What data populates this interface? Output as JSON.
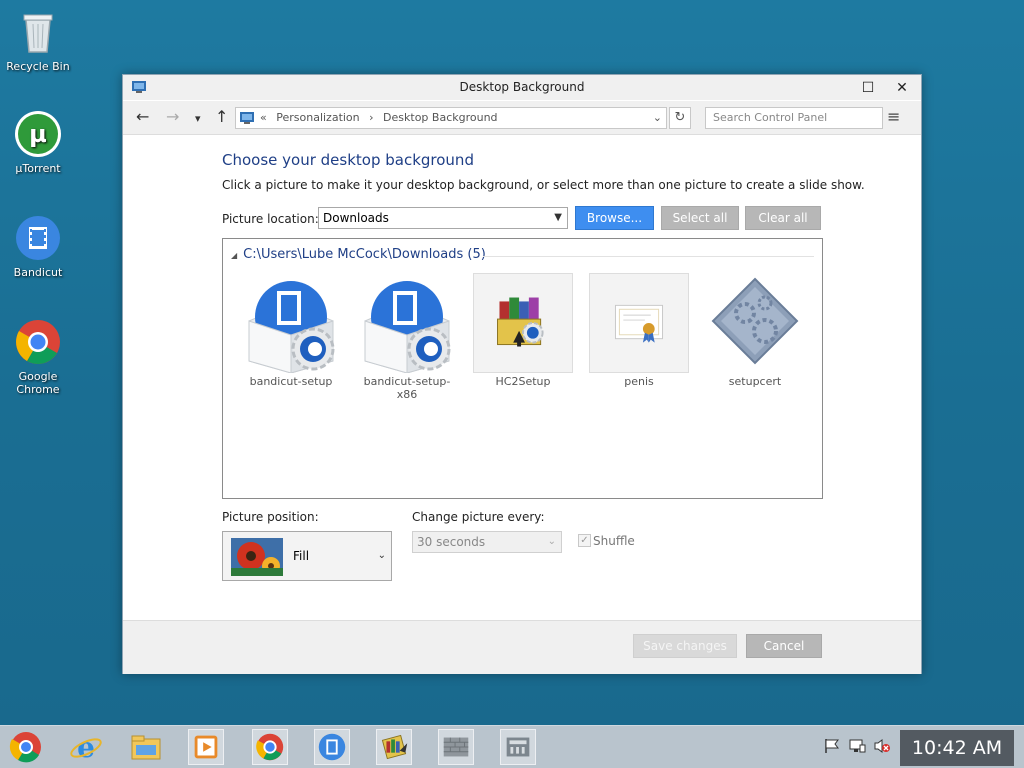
{
  "desktop": {
    "icons": [
      {
        "label": "Recycle Bin"
      },
      {
        "label": "µTorrent"
      },
      {
        "label": "Bandicut"
      },
      {
        "label": "Google Chrome"
      }
    ]
  },
  "window": {
    "title": "Desktop Background",
    "maximize_glyph": "☐",
    "close_glyph": "✕"
  },
  "navbar": {
    "back_glyph": "←",
    "forward_glyph": "→",
    "recent_glyph": "▾",
    "up_glyph": "↑",
    "address_prefix": "«",
    "breadcrumbs": [
      "Personalization",
      "›",
      "Desktop Background"
    ],
    "address_dropdown_glyph": "⌄",
    "refresh_glyph": "↻",
    "search_placeholder": "Search Control Panel",
    "menu_glyph": "≡"
  },
  "content": {
    "heading": "Choose your desktop background",
    "subtext": "Click a picture to make it your desktop background, or select more than one picture to create a slide show.",
    "picture_location_label": "Picture location:",
    "picture_location_value": "Downloads",
    "browse_label": "Browse...",
    "select_all_label": "Select all",
    "clear_all_label": "Clear all",
    "group_header": "C:\\Users\\Lube McCock\\Downloads (5)",
    "group_collapse_glyph": "◢",
    "items": [
      {
        "name": "bandicut-setup"
      },
      {
        "name": "bandicut-setup-x86"
      },
      {
        "name": "HC2Setup"
      },
      {
        "name": "penis"
      },
      {
        "name": "setupcert"
      }
    ],
    "picture_position_label": "Picture position:",
    "picture_position_value": "Fill",
    "change_picture_label": "Change picture every:",
    "change_picture_value": "30 seconds",
    "shuffle_label": "Shuffle",
    "shuffle_checked": true
  },
  "footer": {
    "save_label": "Save changes",
    "cancel_label": "Cancel"
  },
  "taskbar": {
    "clock": "10:42 AM"
  },
  "colors": {
    "desktop": "#1b6f95",
    "accent_blue": "#3e8ef0",
    "heading": "#1f3f86"
  }
}
